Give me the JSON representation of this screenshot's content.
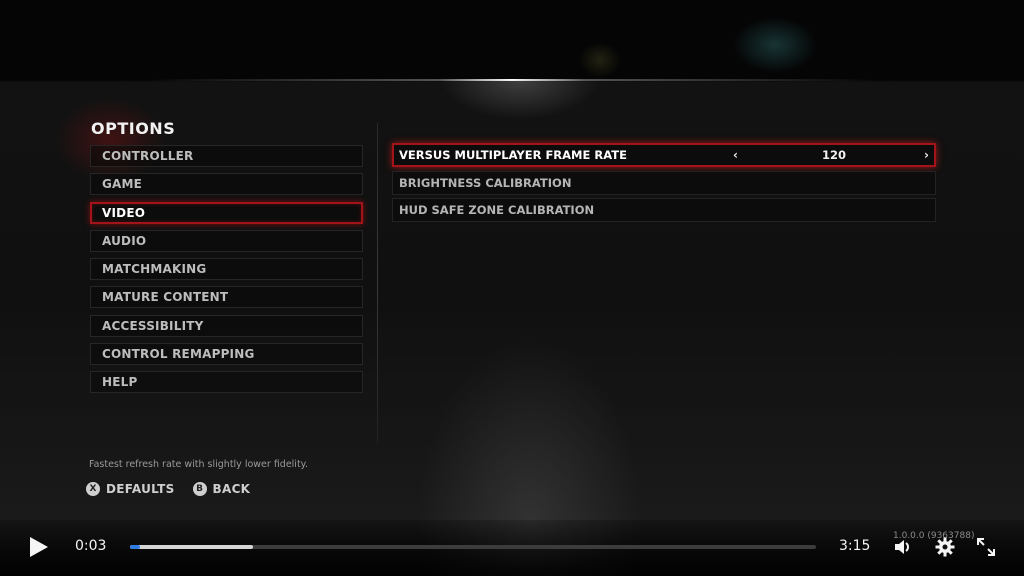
{
  "options": {
    "title": "OPTIONS",
    "menu": [
      {
        "label": "CONTROLLER",
        "active": false
      },
      {
        "label": "GAME",
        "active": false
      },
      {
        "label": "VIDEO",
        "active": true
      },
      {
        "label": "AUDIO",
        "active": false
      },
      {
        "label": "MATCHMAKING",
        "active": false
      },
      {
        "label": "MATURE CONTENT",
        "active": false
      },
      {
        "label": "ACCESSIBILITY",
        "active": false
      },
      {
        "label": "CONTROL REMAPPING",
        "active": false
      },
      {
        "label": "HELP",
        "active": false
      }
    ],
    "settings": [
      {
        "label": "VERSUS MULTIPLAYER FRAME RATE",
        "value": "120",
        "prev_icon": "‹",
        "next_icon": "›",
        "active": true
      },
      {
        "label": "BRIGHTNESS CALIBRATION",
        "active": false
      },
      {
        "label": "HUD SAFE ZONE CALIBRATION",
        "active": false
      }
    ],
    "hint": "Fastest refresh rate with slightly lower fidelity.",
    "buttons": [
      {
        "glyph": "X",
        "label": "DEFAULTS"
      },
      {
        "glyph": "B",
        "label": "BACK"
      }
    ]
  },
  "player": {
    "current_time": "0:03",
    "duration": "3:15",
    "played_fraction": 0.015,
    "buffered_fraction": 0.18,
    "version": "1.0.0.0 (9363788)",
    "accent_color": "#2f7be0"
  }
}
